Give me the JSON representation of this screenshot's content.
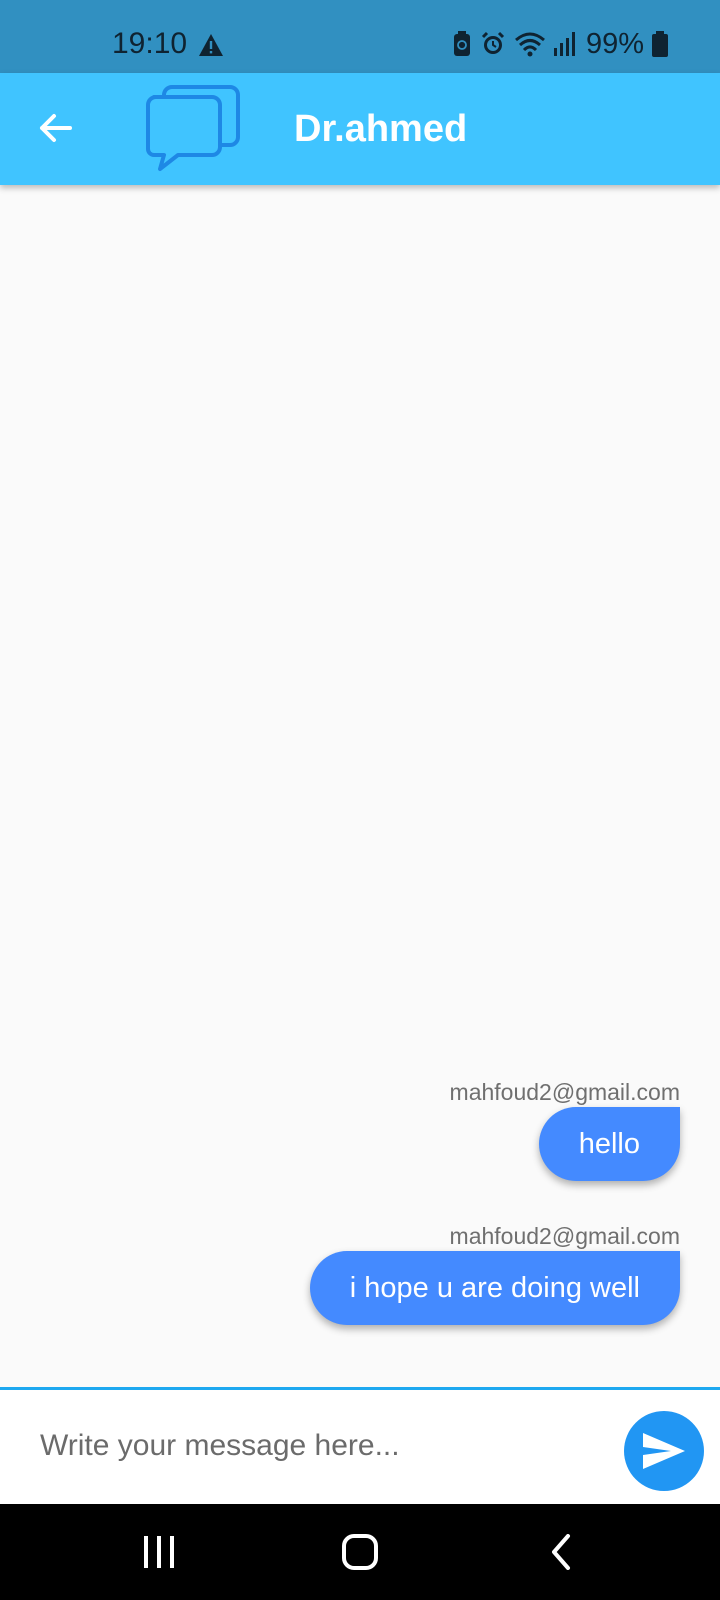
{
  "status_bar": {
    "time": "19:10",
    "battery": "99%",
    "color": "#3190c1"
  },
  "app_bar": {
    "title": "Dr.ahmed",
    "color": "#40c4ff",
    "icons": [
      "back-arrow-icon",
      "chat-bubbles-icon"
    ]
  },
  "messages": [
    {
      "sender": "mahfoud2@gmail.com",
      "text": "hello"
    },
    {
      "sender": "mahfoud2@gmail.com",
      "text": "i hope u are doing well"
    }
  ],
  "composer": {
    "placeholder": "Write your message here...",
    "value": "",
    "send_color": "#2196f3"
  },
  "colors": {
    "bubble": "#448aff",
    "input_border": "#1ea8f0"
  }
}
